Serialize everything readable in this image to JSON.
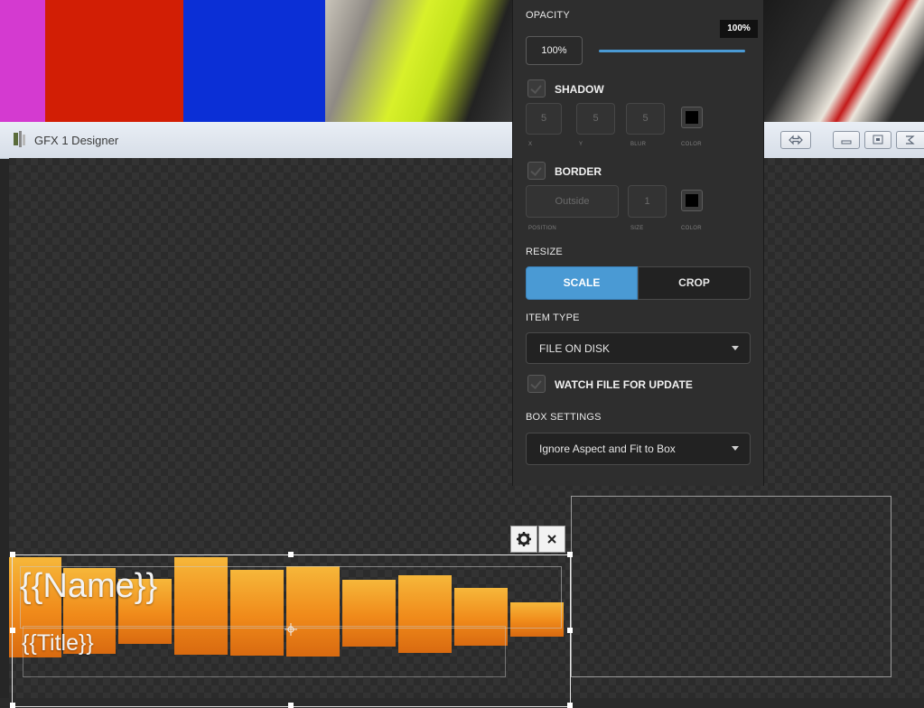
{
  "window": {
    "title": "GFX 1 Designer"
  },
  "panel": {
    "opacity": {
      "label": "OPACITY",
      "value": "100%",
      "tooltip": "100%",
      "level": 1.0
    },
    "shadow": {
      "label": "SHADOW",
      "x": "5",
      "y": "5",
      "blur": "5",
      "x_label": "X",
      "y_label": "Y",
      "blur_label": "BLUR",
      "color_label": "COLOR",
      "color": "#000000"
    },
    "border": {
      "label": "BORDER",
      "position": "Outside",
      "size": "1",
      "position_label": "POSITION",
      "size_label": "SIZE",
      "color_label": "COLOR",
      "color": "#000000"
    },
    "resize": {
      "label": "RESIZE",
      "scale": "SCALE",
      "crop": "CROP",
      "selected": "SCALE"
    },
    "item_type": {
      "label": "ITEM TYPE",
      "value": "FILE ON DISK"
    },
    "watch": {
      "label": "WATCH FILE FOR UPDATE"
    },
    "box_settings": {
      "label": "BOX SETTINGS",
      "value": "Ignore Aspect and Fit to Box"
    }
  },
  "graphic": {
    "name": "{{Name}}",
    "title": "{{Title}}"
  },
  "colors": {
    "accent": "#4a9ad4",
    "orange": "#f08a1a"
  },
  "icons": {
    "settings": "gear-icon",
    "close": "close-icon"
  }
}
